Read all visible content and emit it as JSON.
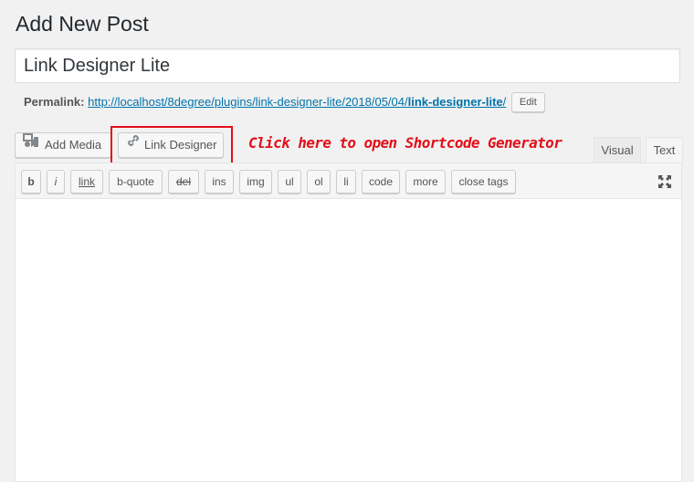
{
  "page": {
    "title": "Add New Post"
  },
  "post": {
    "title_value": "Link Designer Lite"
  },
  "permalink": {
    "label": "Permalink:",
    "url_prefix": "http://localhost/8degree/plugins/link-designer-lite/2018/05/04/",
    "url_slug": "link-designer-lite",
    "url_suffix": "/",
    "edit_label": "Edit"
  },
  "media_buttons": {
    "add_media_label": "Add Media",
    "add_media_icon": "add-media-icon",
    "link_designer_label": "Link Designer",
    "link_designer_icon": "chain-link-icon"
  },
  "annotation": {
    "text": "Click here to open Shortcode Generator",
    "color": "#e2101a"
  },
  "editor_tabs": {
    "visual": "Visual",
    "text": "Text",
    "active": "Text"
  },
  "quicktags": [
    "b",
    "i",
    "link",
    "b-quote",
    "del",
    "ins",
    "img",
    "ul",
    "ol",
    "li",
    "code",
    "more",
    "close tags"
  ],
  "toolbar": {
    "fullscreen_icon": "fullscreen-icon"
  },
  "editor": {
    "content": ""
  },
  "colors": {
    "link": "#0073aa",
    "highlight": "#e2101a",
    "background": "#f1f1f1"
  }
}
